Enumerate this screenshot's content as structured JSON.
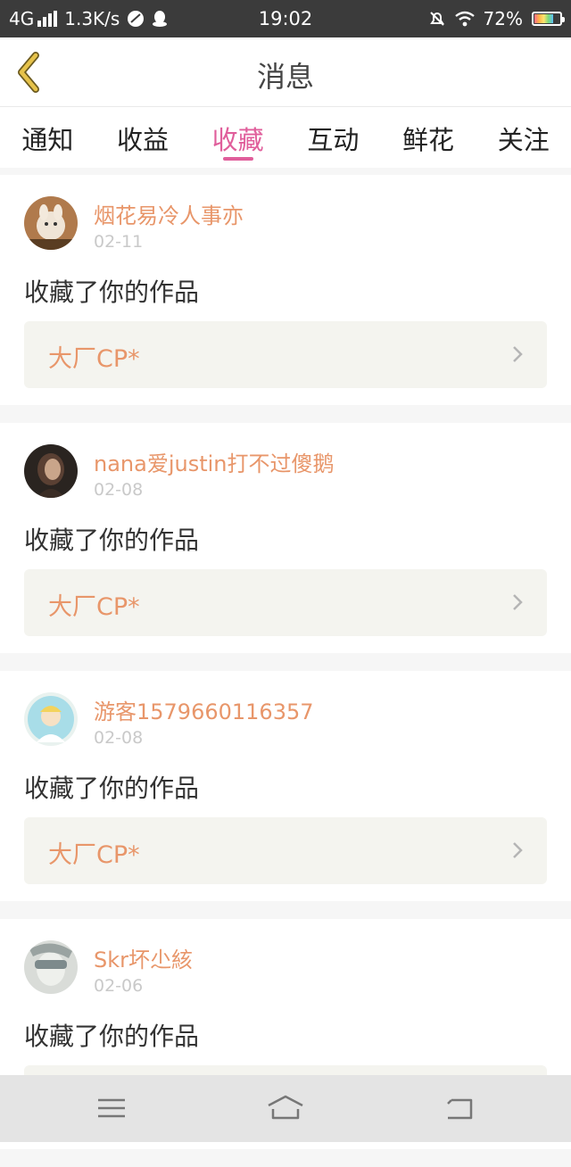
{
  "status_bar": {
    "network": "4G",
    "speed": "1.3K/s",
    "time": "19:02",
    "battery": "72%"
  },
  "header": {
    "title": "消息",
    "back_icon": "chevron-left-icon"
  },
  "tabs": [
    {
      "label": "通知",
      "active": false
    },
    {
      "label": "收益",
      "active": false
    },
    {
      "label": "收藏",
      "active": true
    },
    {
      "label": "互动",
      "active": false
    },
    {
      "label": "鲜花",
      "active": false
    },
    {
      "label": "关注",
      "active": false
    }
  ],
  "items": [
    {
      "user": "烟花易冷人事亦",
      "date": "02-11",
      "action": "收藏了你的作品",
      "work": "大厂CP*"
    },
    {
      "user": "nana爱justin打不过傻鹅",
      "date": "02-08",
      "action": "收藏了你的作品",
      "work": "大厂CP*"
    },
    {
      "user": "游客1579660116357",
      "date": "02-08",
      "action": "收藏了你的作品",
      "work": "大厂CP*"
    },
    {
      "user": "Skr坏尐絯",
      "date": "02-06",
      "action": "收藏了你的作品",
      "work": ""
    }
  ],
  "colors": {
    "accent": "#e05e9b",
    "username": "#e8966a",
    "back_arrow": "#e6c24a"
  }
}
